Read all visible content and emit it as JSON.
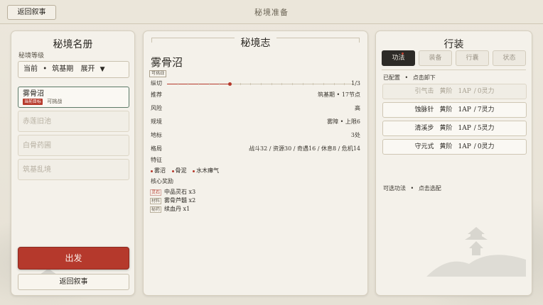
{
  "topbar": {
    "back_label": "返回叙事",
    "title": "秘境准备"
  },
  "left": {
    "title": "秘境名册",
    "level_label": "秘境等级",
    "dropdown": {
      "current": "当前",
      "sep": "•",
      "level": "筑基期",
      "expand": "展开",
      "caret": "▼"
    },
    "realms": [
      {
        "name": "雾骨沼",
        "tag": "当前目标",
        "note": "可挑战",
        "active": true
      },
      {
        "name": "赤莲旧池",
        "active": false
      },
      {
        "name": "白骨药圃",
        "active": false
      },
      {
        "name": "筑基乱境",
        "active": false
      }
    ],
    "go_label": "出发",
    "back_label": "返回叙事"
  },
  "middle": {
    "title": "秘境志",
    "realm_name": "雾骨沼",
    "status_chip": "可挑战",
    "progress": {
      "label": "纵切",
      "value": "1/3",
      "current": 1,
      "total": 3
    },
    "rows": [
      {
        "key": "推荐",
        "value": "筑基期 • 17节点"
      },
      {
        "key": "风险",
        "value": "高"
      },
      {
        "key": "规境",
        "value": "雾障 • 上限6"
      },
      {
        "key": "地标",
        "value": "3处"
      },
      {
        "key": "格局",
        "value": "战斗32 / 资源30 / 奇遇16 / 休息8 / 危机14"
      }
    ],
    "features_label": "特征",
    "features": [
      "雾沼",
      "骨泥",
      "水木瘴气"
    ],
    "rewards_label": "核心奖励",
    "rewards": [
      {
        "chip": "灵石",
        "text": "中品灵石 x3",
        "red": true
      },
      {
        "chip": "材料",
        "text": "雾骨芦髓 x2",
        "red": false
      },
      {
        "chip": "秘药",
        "text": "续血丹 x1",
        "red": false
      }
    ]
  },
  "right": {
    "title": "行装",
    "tabs": [
      "功法",
      "装备",
      "行囊",
      "状态"
    ],
    "equipped_label": "已配置",
    "equipped_hint": "点击卸下",
    "skills": [
      {
        "name": "引气击",
        "grade": "黄阶",
        "ap": "1AP",
        "cost": "0灵力",
        "dim": true
      },
      {
        "name": "蚀脉针",
        "grade": "黄阶",
        "ap": "1AP",
        "cost": "7灵力",
        "dim": false
      },
      {
        "name": "清溪步",
        "grade": "黄阶",
        "ap": "1AP",
        "cost": "5灵力",
        "dim": false
      },
      {
        "name": "守元式",
        "grade": "黄阶",
        "ap": "1AP",
        "cost": "0灵力",
        "dim": false
      }
    ],
    "available_label": "可选功法",
    "available_hint": "点击选配",
    "dot": "•"
  },
  "colors": {
    "accent_red": "#b5392c",
    "dark_tab": "#2d2b27",
    "selected_border": "#5c7a68"
  }
}
